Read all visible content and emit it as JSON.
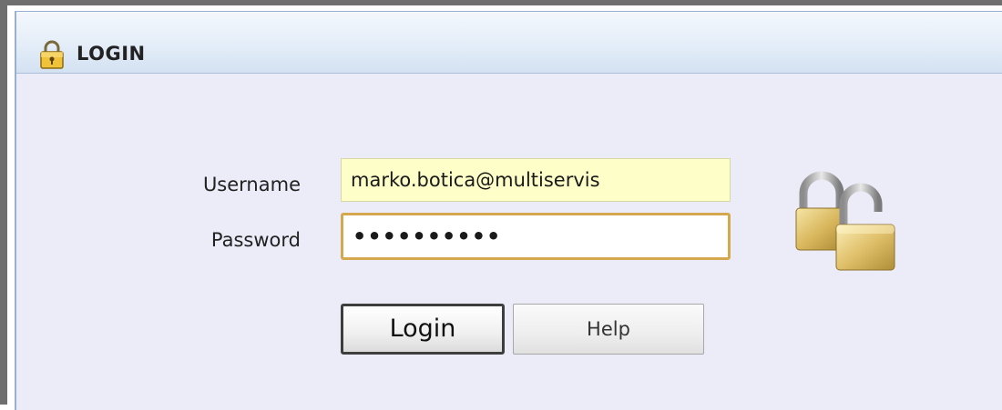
{
  "window": {
    "title": "LOGIN",
    "title_icon": "padlock-icon"
  },
  "form": {
    "username_label": "Username",
    "username_value": "marko.botica@multiservis",
    "password_label": "Password",
    "password_value": "••••••••••",
    "login_button": "Login",
    "help_button": "Help",
    "decoration_icon": "padlocks-icon"
  },
  "colors": {
    "username_field_bg": "#fefec8",
    "password_focus_border": "#d6a84d",
    "panel_bg": "#ecebf8"
  }
}
